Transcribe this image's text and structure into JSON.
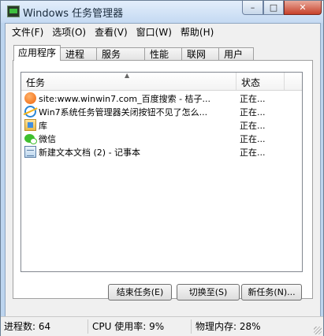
{
  "window": {
    "title": "Windows 任务管理器",
    "icon": "task-manager-icon",
    "controls": {
      "minimize": "–",
      "maximize": "□",
      "close": "✕"
    }
  },
  "menu": [
    "文件(F)",
    "选项(O)",
    "查看(V)",
    "窗口(W)",
    "帮助(H)"
  ],
  "tabs": [
    "应用程序",
    "进程",
    "服务",
    "性能",
    "联网",
    "用户"
  ],
  "active_tab": "应用程序",
  "table": {
    "sort_indicator": "▲",
    "columns": [
      "任务",
      "状态"
    ],
    "rows": [
      {
        "icon": "taobao-icon",
        "name": "site:www.winwin7.com_百度搜索 - 桔子...",
        "status": "正在..."
      },
      {
        "icon": "internet-explorer-icon",
        "name": "Win7系统任务管理器关闭按钮不见了怎么...",
        "status": "正在..."
      },
      {
        "icon": "library-icon",
        "name": "库",
        "status": "正在..."
      },
      {
        "icon": "wechat-icon",
        "name": "微信",
        "status": "正在..."
      },
      {
        "icon": "notepad-icon",
        "name": "新建文本文档 (2) - 记事本",
        "status": "正在..."
      }
    ]
  },
  "buttons": {
    "end_task": "结束任务(E)",
    "switch_to": "切换至(S)",
    "new_task": "新任务(N)..."
  },
  "statusbar": {
    "processes": "进程数: 64",
    "cpu": "CPU 使用率: 9%",
    "memory": "物理内存: 28%"
  },
  "colors": {
    "titlebar": "#c4d9f2",
    "close_button": "#c7412a",
    "window_border": "#6b7f95"
  }
}
